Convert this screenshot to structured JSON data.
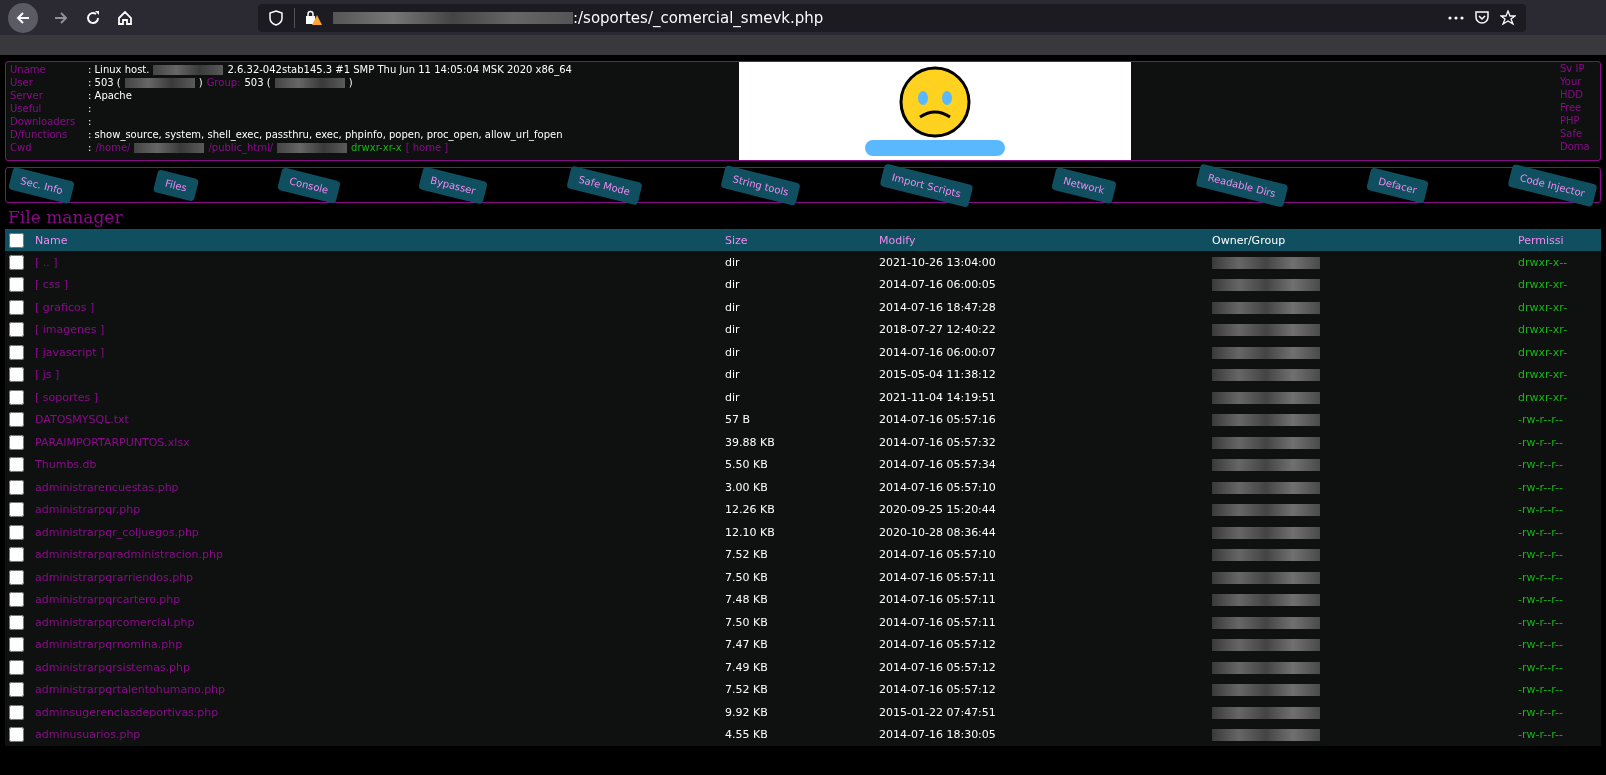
{
  "browser": {
    "url_path": ":/soportes/_comercial_smevk.php"
  },
  "info": {
    "rows": [
      {
        "label": "Uname",
        "parts": [
          {
            "kind": "text",
            "text": ": Linux host."
          },
          {
            "kind": "redacted"
          },
          {
            "kind": "text",
            "text": "2.6.32-042stab145.3 #1 SMP Thu Jun 11 14:05:04 MSK 2020 x86_64"
          }
        ]
      },
      {
        "label": "User",
        "parts": [
          {
            "kind": "text",
            "text": ": 503 ("
          },
          {
            "kind": "redacted"
          },
          {
            "kind": "text",
            "text": ")"
          },
          {
            "kind": "label",
            "text": "Group:"
          },
          {
            "kind": "text",
            "text": "503 ("
          },
          {
            "kind": "redacted"
          },
          {
            "kind": "text",
            "text": ")"
          }
        ]
      },
      {
        "label": "Server",
        "parts": [
          {
            "kind": "text",
            "text": ": Apache"
          }
        ]
      },
      {
        "label": "Useful",
        "parts": [
          {
            "kind": "text",
            "text": ":"
          }
        ]
      },
      {
        "label": "Downloaders",
        "parts": [
          {
            "kind": "text",
            "text": ":"
          }
        ]
      },
      {
        "label": "D/functions",
        "parts": [
          {
            "kind": "text",
            "text": ": show_source, system, shell_exec, passthru, exec, phpinfo, popen, proc_open, allow_url_fopen"
          }
        ]
      },
      {
        "label": "Cwd",
        "parts": [
          {
            "kind": "text",
            "text": ":"
          },
          {
            "kind": "link",
            "text": "/home/"
          },
          {
            "kind": "redacted"
          },
          {
            "kind": "link",
            "text": "/public_html/"
          },
          {
            "kind": "redacted"
          },
          {
            "kind": "perm",
            "text": "drwxr-xr-x"
          },
          {
            "kind": "link",
            "text": "[ home ]"
          }
        ]
      }
    ],
    "right_labels": [
      "Sv IP",
      "Your",
      "HDD",
      "Free",
      "PHP",
      "Safe",
      "Doma"
    ]
  },
  "tabs": [
    {
      "label": "Sec. Info"
    },
    {
      "label": "Files"
    },
    {
      "label": "Console"
    },
    {
      "label": "Bypasser"
    },
    {
      "label": "Safe Mode"
    },
    {
      "label": "String tools"
    },
    {
      "label": "Import Scripts"
    },
    {
      "label": "Network"
    },
    {
      "label": "Readable Dirs"
    },
    {
      "label": "Defacer"
    },
    {
      "label": "Code Injector"
    }
  ],
  "file_manager": {
    "title": "File manager",
    "select_all_checked": false,
    "columns": [
      "Name",
      "Size",
      "Modify",
      "Owner/Group",
      "Permissi"
    ],
    "rows": [
      {
        "name": "[ .. ]",
        "size": "dir",
        "modify": "2021-10-26 13:04:00",
        "perms": "drwxr-x--",
        "checked": false
      },
      {
        "name": "[ css ]",
        "size": "dir",
        "modify": "2014-07-16 06:00:05",
        "perms": "drwxr-xr-",
        "checked": false
      },
      {
        "name": "[ graficos ]",
        "size": "dir",
        "modify": "2014-07-16 18:47:28",
        "perms": "drwxr-xr-",
        "checked": false
      },
      {
        "name": "[ imagenes ]",
        "size": "dir",
        "modify": "2018-07-27 12:40:22",
        "perms": "drwxr-xr-",
        "checked": false
      },
      {
        "name": "[ javascript ]",
        "size": "dir",
        "modify": "2014-07-16 06:00:07",
        "perms": "drwxr-xr-",
        "checked": false
      },
      {
        "name": "[ js ]",
        "size": "dir",
        "modify": "2015-05-04 11:38:12",
        "perms": "drwxr-xr-",
        "checked": false
      },
      {
        "name": "[ soportes ]",
        "size": "dir",
        "modify": "2021-11-04 14:19:51",
        "perms": "drwxr-xr-",
        "checked": false
      },
      {
        "name": "DATOSMYSQL.txt",
        "size": "57 B",
        "modify": "2014-07-16 05:57:16",
        "perms": "-rw-r--r--",
        "checked": false
      },
      {
        "name": "PARAIMPORTARPUNTOS.xlsx",
        "size": "39.88 KB",
        "modify": "2014-07-16 05:57:32",
        "perms": "-rw-r--r--",
        "checked": false
      },
      {
        "name": "Thumbs.db",
        "size": "5.50 KB",
        "modify": "2014-07-16 05:57:34",
        "perms": "-rw-r--r--",
        "checked": false
      },
      {
        "name": "administrarencuestas.php",
        "size": "3.00 KB",
        "modify": "2014-07-16 05:57:10",
        "perms": "-rw-r--r--",
        "checked": false
      },
      {
        "name": "administrarpqr.php",
        "size": "12.26 KB",
        "modify": "2020-09-25 15:20:44",
        "perms": "-rw-r--r--",
        "checked": false
      },
      {
        "name": "administrarpqr_coljuegos.php",
        "size": "12.10 KB",
        "modify": "2020-10-28 08:36:44",
        "perms": "-rw-r--r--",
        "checked": false
      },
      {
        "name": "administrarpqradministracion.php",
        "size": "7.52 KB",
        "modify": "2014-07-16 05:57:10",
        "perms": "-rw-r--r--",
        "checked": false
      },
      {
        "name": "administrarpqrarriendos.php",
        "size": "7.50 KB",
        "modify": "2014-07-16 05:57:11",
        "perms": "-rw-r--r--",
        "checked": false
      },
      {
        "name": "administrarpqrcartero.php",
        "size": "7.48 KB",
        "modify": "2014-07-16 05:57:11",
        "perms": "-rw-r--r--",
        "checked": false
      },
      {
        "name": "administrarpqrcomercial.php",
        "size": "7.50 KB",
        "modify": "2014-07-16 05:57:11",
        "perms": "-rw-r--r--",
        "checked": false
      },
      {
        "name": "administrarpqrnomina.php",
        "size": "7.47 KB",
        "modify": "2014-07-16 05:57:12",
        "perms": "-rw-r--r--",
        "checked": false
      },
      {
        "name": "administrarpqrsistemas.php",
        "size": "7.49 KB",
        "modify": "2014-07-16 05:57:12",
        "perms": "-rw-r--r--",
        "checked": false
      },
      {
        "name": "administrarpqrtalentohumano.php",
        "size": "7.52 KB",
        "modify": "2014-07-16 05:57:12",
        "perms": "-rw-r--r--",
        "checked": false
      },
      {
        "name": "adminsugerenciasdeportivas.php",
        "size": "9.92 KB",
        "modify": "2015-01-22 07:47:51",
        "perms": "-rw-r--r--",
        "checked": false
      },
      {
        "name": "adminusuarios.php",
        "size": "4.55 KB",
        "modify": "2014-07-16 18:30:05",
        "perms": "-rw-r--r--",
        "checked": false
      }
    ]
  }
}
